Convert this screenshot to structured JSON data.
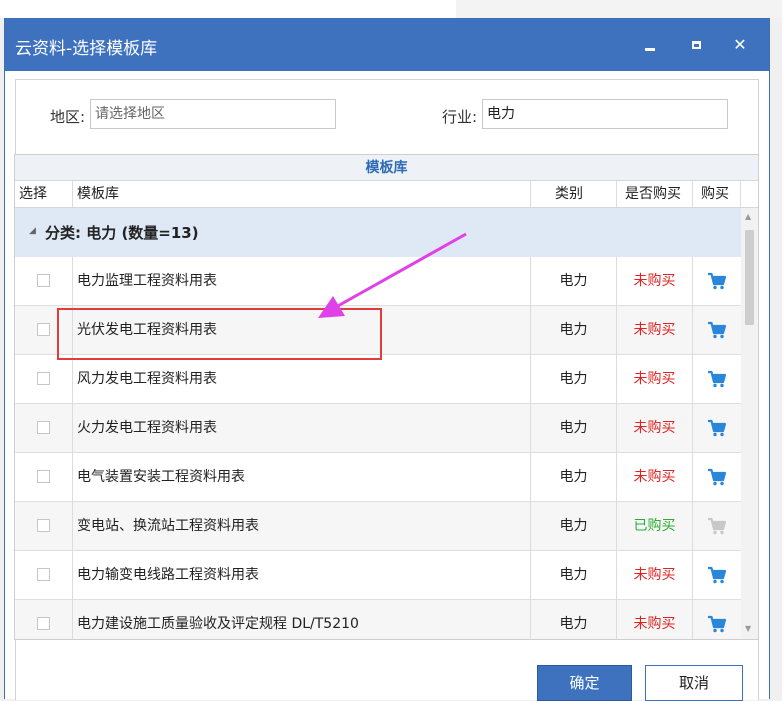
{
  "window": {
    "title": "云资料-选择模板库"
  },
  "filters": {
    "region_label": "地区:",
    "region_placeholder": "请选择地区",
    "industry_label": "行业:",
    "industry_value": "电力"
  },
  "grid": {
    "title": "模板库",
    "columns": [
      "选择",
      "模板库",
      "类别",
      "是否购买",
      "购买"
    ],
    "group_label": "分类: 电力 (数量=13)",
    "rows": [
      {
        "name": "电力监理工程资料用表",
        "category": "电力",
        "status": "未购买",
        "purchased": false
      },
      {
        "name": "光伏发电工程资料用表",
        "category": "电力",
        "status": "未购买",
        "purchased": false
      },
      {
        "name": "风力发电工程资料用表",
        "category": "电力",
        "status": "未购买",
        "purchased": false
      },
      {
        "name": "火力发电工程资料用表",
        "category": "电力",
        "status": "未购买",
        "purchased": false
      },
      {
        "name": "电气装置安装工程资料用表",
        "category": "电力",
        "status": "未购买",
        "purchased": false
      },
      {
        "name": "变电站、换流站工程资料用表",
        "category": "电力",
        "status": "已购买",
        "purchased": true
      },
      {
        "name": "电力输变电线路工程资料用表",
        "category": "电力",
        "status": "未购买",
        "purchased": false
      },
      {
        "name": "电力建设施工质量验收及评定规程 DL/T5210",
        "category": "电力",
        "status": "未购买",
        "purchased": false
      }
    ]
  },
  "buttons": {
    "ok": "确定",
    "cancel": "取消"
  },
  "colors": {
    "titlebar": "#3e72bf",
    "not_purchased": "#e02424",
    "purchased": "#2bab32",
    "cart_active": "#2a86d8",
    "cart_inactive": "#c8c8c8",
    "annotation": "#e23c3c",
    "arrow": "#e040e8"
  }
}
